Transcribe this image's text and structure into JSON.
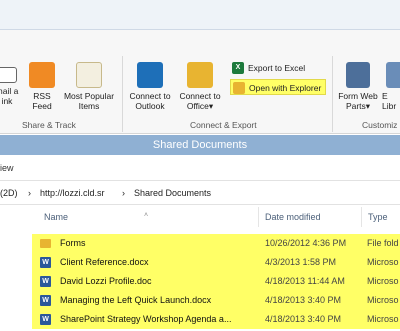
{
  "ribbon": {
    "email_label": "mail a\nink",
    "rss_label": "RSS\nFeed",
    "popular_label": "Most Popular\nItems",
    "share_group": "Share & Track",
    "outlook_label": "Connect to\nOutlook",
    "office_label": "Connect to\nOffice",
    "office_caret": "▾",
    "excel_label": "Export to Excel",
    "explorer_label": "Open with Explorer",
    "connect_group": "Connect & Export",
    "formweb_label": "Form Web\nParts",
    "formweb_caret": "▾",
    "lib_label": "E\nLibr",
    "custom_group": "Customiz"
  },
  "window": {
    "title": "Shared Documents",
    "menu_text": "iew"
  },
  "address": {
    "prefix": "(2D)",
    "sep1": "›",
    "host": "http://lozzi.cld.sr",
    "sep2": "›",
    "folder": "Shared Documents"
  },
  "columns": {
    "name": "Name",
    "date": "Date modified",
    "type": "Type"
  },
  "files": [
    {
      "name": "Forms",
      "date": "10/26/2012 4:36 PM",
      "type": "File fold",
      "kind": "folder"
    },
    {
      "name": "Client Reference.docx",
      "date": "4/3/2013 1:58 PM",
      "type": "Microso",
      "kind": "doc"
    },
    {
      "name": "David Lozzi Profile.doc",
      "date": "4/18/2013 11:44 AM",
      "type": "Microso",
      "kind": "doc"
    },
    {
      "name": "Managing the Left Quick Launch.docx",
      "date": "4/18/2013 3:40 PM",
      "type": "Microso",
      "kind": "doc"
    },
    {
      "name": "SharePoint Strategy Workshop Agenda a...",
      "date": "4/18/2013 3:40 PM",
      "type": "Microso",
      "kind": "doc"
    }
  ],
  "colors": {
    "highlight": "#ffff66",
    "titlebar": "#8fb0d3"
  }
}
